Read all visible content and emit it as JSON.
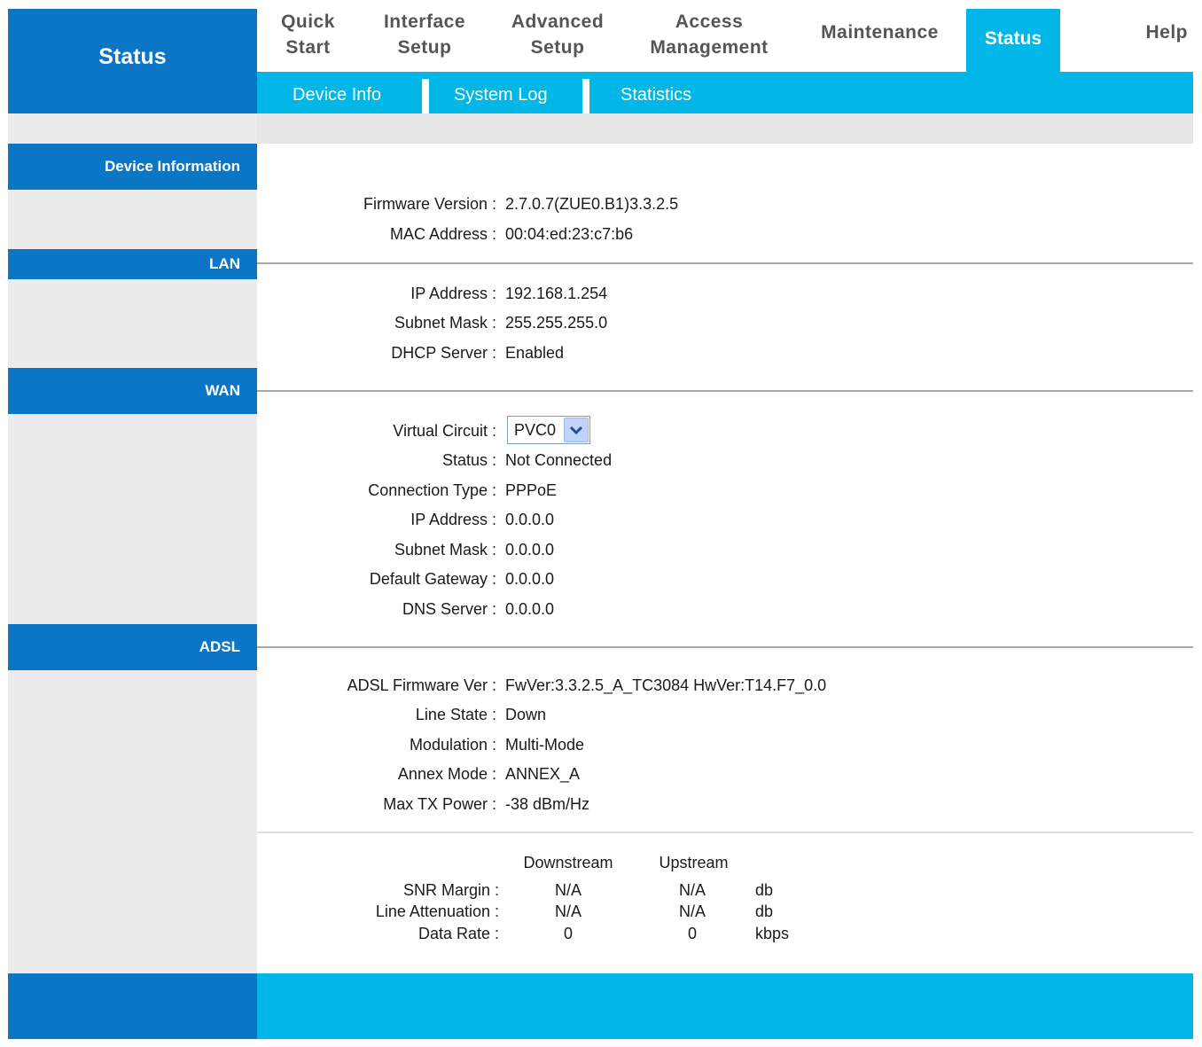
{
  "brand": {
    "title": "Status"
  },
  "nav": {
    "items": [
      {
        "line1": "Quick",
        "line2": "Start"
      },
      {
        "line1": "Interface",
        "line2": "Setup"
      },
      {
        "line1": "Advanced",
        "line2": "Setup"
      },
      {
        "line1": "Access",
        "line2": "Management"
      },
      {
        "line1": "Maintenance"
      },
      {
        "line1": "Status"
      },
      {
        "line1": "Help"
      }
    ],
    "active": "Status"
  },
  "subnav": {
    "items": [
      "Device Info",
      "System Log",
      "Statistics"
    ]
  },
  "sections": {
    "device": "Device Information",
    "lan": "LAN",
    "wan": "WAN",
    "adsl": "ADSL"
  },
  "device": {
    "firmware_label": "Firmware Version :",
    "firmware_value": "2.7.0.7(ZUE0.B1)3.3.2.5",
    "mac_label": "MAC Address :",
    "mac_value": "00:04:ed:23:c7:b6"
  },
  "lan": {
    "ip_label": "IP Address :",
    "ip_value": "192.168.1.254",
    "mask_label": "Subnet Mask :",
    "mask_value": "255.255.255.0",
    "dhcp_label": "DHCP Server :",
    "dhcp_value": "Enabled"
  },
  "wan": {
    "vc_label": "Virtual Circuit :",
    "vc_value": "PVC0",
    "status_label": "Status :",
    "status_value": "Not Connected",
    "conn_label": "Connection Type :",
    "conn_value": "PPPoE",
    "ip_label": "IP Address :",
    "ip_value": "0.0.0.0",
    "mask_label": "Subnet Mask :",
    "mask_value": "0.0.0.0",
    "gw_label": "Default Gateway :",
    "gw_value": "0.0.0.0",
    "dns_label": "DNS Server :",
    "dns_value": "0.0.0.0"
  },
  "adsl": {
    "fw_label": "ADSL Firmware Ver :",
    "fw_value": "FwVer:3.3.2.5_A_TC3084 HwVer:T14.F7_0.0",
    "line_label": "Line State :",
    "line_value": "Down",
    "mod_label": "Modulation :",
    "mod_value": "Multi-Mode",
    "annex_label": "Annex Mode :",
    "annex_value": "ANNEX_A",
    "tx_label": "Max TX Power :",
    "tx_value": "-38 dBm/Hz"
  },
  "stats": {
    "col_down": "Downstream",
    "col_up": "Upstream",
    "rows": [
      {
        "label": "SNR Margin :",
        "down": "N/A",
        "up": "N/A",
        "unit": "db"
      },
      {
        "label": "Line Attenuation :",
        "down": "N/A",
        "up": "N/A",
        "unit": "db"
      },
      {
        "label": "Data Rate :",
        "down": "0",
        "up": "0",
        "unit": "kbps"
      }
    ]
  },
  "colors": {
    "dark_blue": "#0b76c5",
    "cyan": "#00b7e7"
  }
}
